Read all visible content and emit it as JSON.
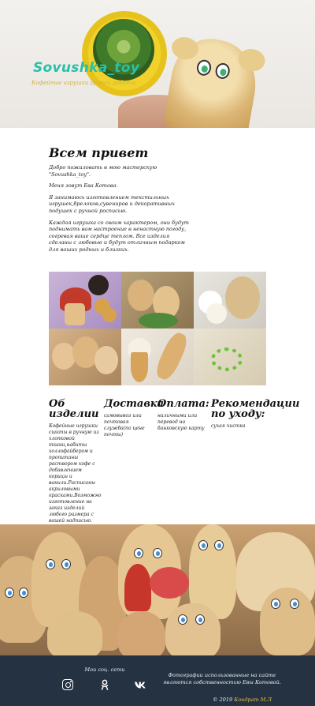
{
  "hero": {
    "brand": "Sovushka_toy",
    "tagline": "Кофейные игрушки ручной работы"
  },
  "intro": {
    "title": "Всем привет",
    "paragraphs": [
      "Добро пожаловать в мою мастерскую \"Sovushka_toy\".",
      "Меня зовут Ева Котова.",
      "Я занимаюсь изготовлением текстильных игрушек,брелоков,сувениров и декоративных подушек с ручной росписью.",
      "Каждая игрушка со своим характером, они будут поднимать вам настроение в ненастную погоду, согревая ваше сердце теплом. Все изделия сделаны с любовью и будут отличным подарком для ваших родных и близких."
    ]
  },
  "info": [
    {
      "title": "Об изделии",
      "text": "Кофейные игрушки сшиты в ручную из хлопковой ткани,набиты холлофайбером и пропитаны раствором кофе с добавлением корицы и ванили.Расписаны акриловыми красками.Возможно изготовление на заказ изделий любого размера с вашей надписью."
    },
    {
      "title": "Доставка",
      "text": "самовывоз или почтовая служба(по цене почты)"
    },
    {
      "title": "Оплата:",
      "text": "наличными или перевод на банковскую карту"
    },
    {
      "title": "Рекомендации по уходу:",
      "text": "сухая чистка"
    }
  ],
  "footer": {
    "social_title": "Мои соц. сети",
    "social_icons": [
      "instagram-icon",
      "odnoklassniki-icon",
      "vk-icon"
    ],
    "photo_note": "Фотографии использованные на сайте являются собственностью Евы Котовой.",
    "copyright_prefix": "© 2019",
    "copyright_name": "Кондрат М.Л",
    "background": "#243242",
    "name_color": "#e3c345"
  },
  "colors": {
    "brand": "#28c0a8",
    "tagline": "#d3b23a"
  }
}
